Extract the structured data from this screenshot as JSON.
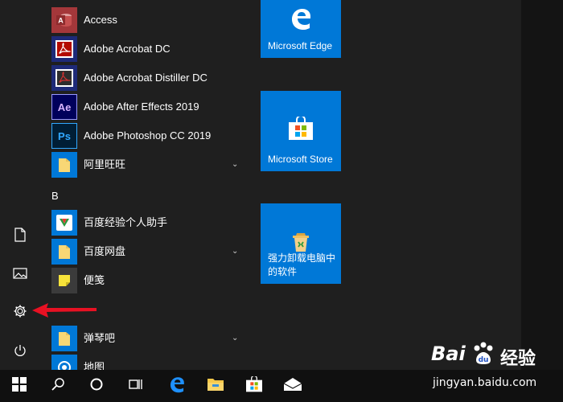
{
  "apps": [
    {
      "label": "Access",
      "icon": "access-icon",
      "color": "#a4373a"
    },
    {
      "label": "Adobe Acrobat DC",
      "icon": "acrobat-icon",
      "color": "#1e2a78"
    },
    {
      "label": "Adobe Acrobat Distiller DC",
      "icon": "acrobat-distiller-icon",
      "color": "#1e2a78"
    },
    {
      "label": "Adobe After Effects 2019",
      "icon": "after-effects-icon",
      "color": "#00005b",
      "badge": "Ae"
    },
    {
      "label": "Adobe Photoshop CC 2019",
      "icon": "photoshop-icon",
      "color": "#001e36",
      "badge": "Ps"
    },
    {
      "label": "阿里旺旺",
      "icon": "folder-icon",
      "expandable": true
    }
  ],
  "section_b": {
    "letter": "B"
  },
  "apps_b": [
    {
      "label": "百度经验个人助手",
      "icon": "baidu-jingyan-icon"
    },
    {
      "label": "百度网盘",
      "icon": "folder-icon",
      "expandable": true
    },
    {
      "label": "便笺",
      "icon": "sticky-notes-icon"
    }
  ],
  "apps_c": [
    {
      "label": "弹琴吧",
      "icon": "folder-icon",
      "expandable": true
    },
    {
      "label": "地图",
      "icon": "maps-icon"
    }
  ],
  "tiles": [
    {
      "label": "Microsoft Edge",
      "icon": "edge-icon"
    },
    {
      "label": "Microsoft Store",
      "icon": "store-icon"
    },
    {
      "label_line1": "强力卸载电脑中",
      "label_line2": "的软件",
      "icon": "uninstaller-icon"
    }
  ],
  "rail": [
    "documents-icon",
    "pictures-icon",
    "settings-icon",
    "power-icon"
  ],
  "taskbar": [
    "windows-start-icon",
    "search-icon",
    "cortana-icon",
    "task-view-icon",
    "edge-icon",
    "file-explorer-icon",
    "store-icon",
    "mail-icon"
  ],
  "watermark": {
    "brand": "Bai",
    "brand2": "经验",
    "url": "jingyan.baidu.com"
  },
  "colors": {
    "accent": "#0078d7",
    "folder": "#f8d775",
    "background": "#1f1f1f",
    "taskbar": "#101010",
    "arrow": "#e81123"
  }
}
